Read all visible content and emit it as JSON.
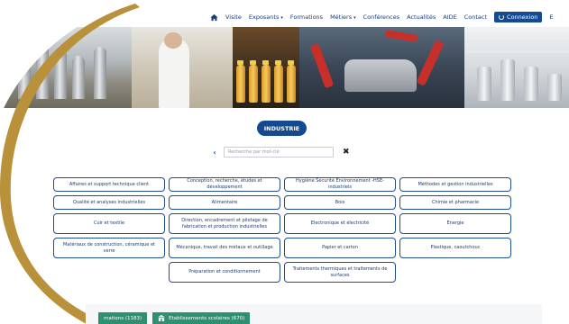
{
  "nav": {
    "items": [
      {
        "label": "Visite",
        "caret": false
      },
      {
        "label": "Exposants",
        "caret": true
      },
      {
        "label": "Formations",
        "caret": false
      },
      {
        "label": "Métiers",
        "caret": true
      },
      {
        "label": "Conférences",
        "caret": false
      },
      {
        "label": "Actualités",
        "caret": false
      },
      {
        "label": "AIDE",
        "caret": false
      },
      {
        "label": "Contact",
        "caret": false
      }
    ],
    "login_label": "Connexion",
    "overflow_text": "E",
    "home_icon": "home-icon",
    "login_icon": "power-icon"
  },
  "banner": {
    "photos": [
      "grain-silos",
      "lab-worker",
      "juice-bottles",
      "car-assembly-robots",
      "processing-plant"
    ]
  },
  "badge": {
    "label": "INDUSTRIE"
  },
  "search": {
    "placeholder": "Recherche par mot-clé",
    "value": "",
    "back_icon": "chevron-left-icon",
    "clear_icon": "close-icon"
  },
  "categories": [
    "Affaires et support technique client",
    "Conception, recherche, études et développement",
    "Hygiène Sécurité Environnement -HSE- industriels",
    "Méthodes et gestion industrielles",
    "Qualité et analyses industrielles",
    "Alimentaire",
    "Bois",
    "Chimie et pharmacie",
    "Cuir et textile",
    "Direction, encadrement et pilotage de fabrication et production industrielles",
    "Electronique et électricité",
    "Energie",
    "Matériaux de construction, céramique et verre",
    "Mécanique, travail des métaux et outillage",
    "Papier et carton",
    "Plastique, caoutchouc",
    "",
    "Préparation et conditionnement",
    "Traitements thermiques et traitements de surfaces",
    ""
  ],
  "bottom_tabs": [
    {
      "label": "mations (1183)",
      "icon": ""
    },
    {
      "label": "Etablissements scolaires (670)",
      "icon": "school-icon"
    }
  ],
  "colors": {
    "primary": "#144a8f",
    "accent_green": "#2e8f72",
    "swoosh_gold": "#b8913a"
  }
}
